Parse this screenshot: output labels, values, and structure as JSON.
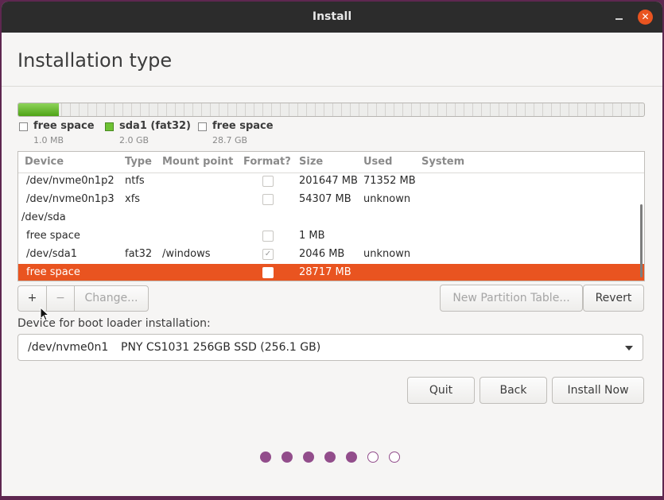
{
  "window": {
    "title": "Install",
    "close_glyph": "✕"
  },
  "page": {
    "heading": "Installation type"
  },
  "usage_bar": {
    "segments": [
      {
        "name": "free space",
        "fraction": 0.0,
        "color": "#ededeb"
      },
      {
        "name": "sda1 (fat32)",
        "fraction": 0.065,
        "color": "#6ec234"
      },
      {
        "name": "free space",
        "fraction": 0.935,
        "color": "#ededeb"
      }
    ]
  },
  "legend": [
    {
      "label": "free space",
      "size": "1.0 MB",
      "swatch": "white"
    },
    {
      "label": "sda1 (fat32)",
      "size": "2.0 GB",
      "swatch": "green"
    },
    {
      "label": "free space",
      "size": "28.7 GB",
      "swatch": "white"
    }
  ],
  "table": {
    "headers": {
      "device": "Device",
      "type": "Type",
      "mount": "Mount point",
      "format": "Format?",
      "size": "Size",
      "used": "Used",
      "system": "System"
    },
    "rows": [
      {
        "device": "/dev/nvme0n1p2",
        "type": "ntfs",
        "mount": "",
        "format": false,
        "has_check": true,
        "size": "201647 MB",
        "used": "71352 MB",
        "indent": true
      },
      {
        "device": "/dev/nvme0n1p3",
        "type": "xfs",
        "mount": "",
        "format": false,
        "has_check": true,
        "size": "54307 MB",
        "used": "unknown",
        "indent": true
      },
      {
        "device": "/dev/sda",
        "type": "",
        "mount": "",
        "format": false,
        "has_check": false,
        "size": "",
        "used": "",
        "indent": false
      },
      {
        "device": "free space",
        "type": "",
        "mount": "",
        "format": false,
        "has_check": true,
        "size": "1 MB",
        "used": "",
        "indent": true
      },
      {
        "device": "/dev/sda1",
        "type": "fat32",
        "mount": "/windows",
        "format": true,
        "has_check": true,
        "size": "2046 MB",
        "used": "unknown",
        "indent": true
      },
      {
        "device": "free space",
        "type": "",
        "mount": "",
        "format": false,
        "has_check": true,
        "size": "28717 MB",
        "used": "",
        "indent": true,
        "selected": true
      }
    ]
  },
  "partition_buttons": {
    "add": "+",
    "remove": "−",
    "change": "Change...",
    "new_table": "New Partition Table...",
    "revert": "Revert"
  },
  "boot_loader": {
    "label": "Device for boot loader installation:",
    "device": "/dev/nvme0n1",
    "description": "PNY CS1031 256GB SSD (256.1 GB)"
  },
  "nav_buttons": {
    "quit": "Quit",
    "back": "Back",
    "install": "Install Now"
  },
  "progress": {
    "total_steps": 7,
    "completed_steps": 5
  },
  "colors": {
    "accent": "#e95420",
    "progress_dot": "#924d8b",
    "titlebar": "#2c2c2c"
  }
}
